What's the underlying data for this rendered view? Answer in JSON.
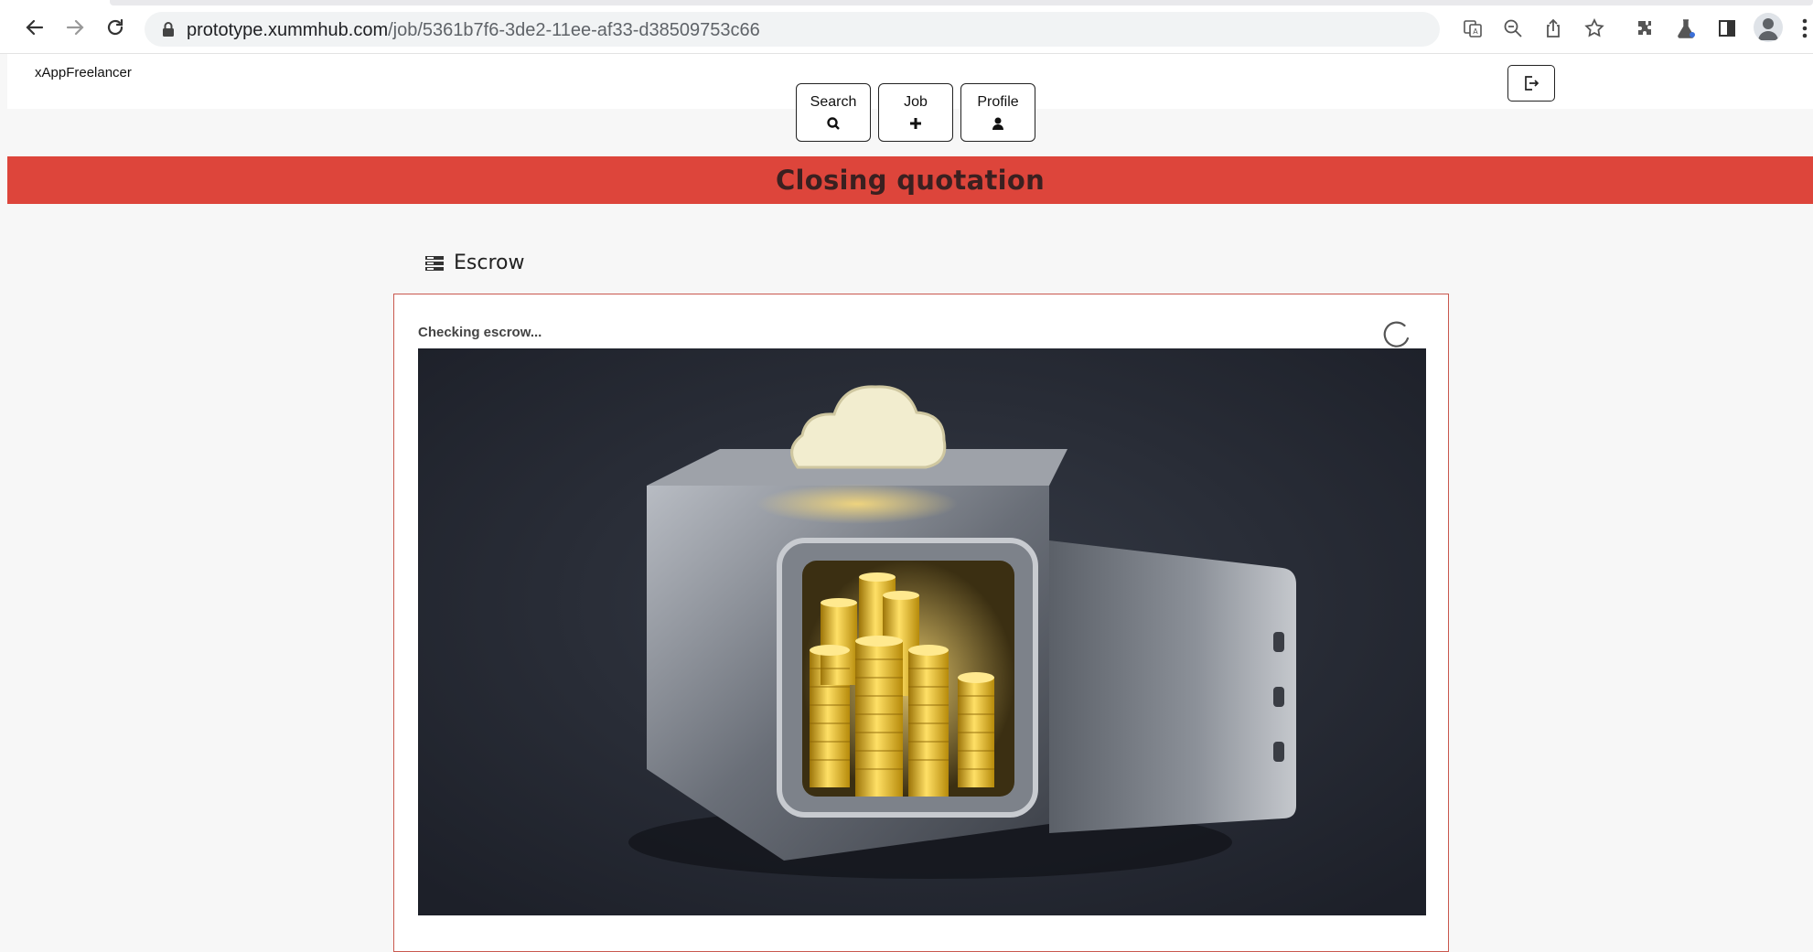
{
  "browser": {
    "url_domain": "prototype.xummhub.com",
    "url_path": "/job/5361b7f6-3de2-11ee-af33-d38509753c66",
    "nav_icons": [
      "back-icon",
      "forward-icon",
      "reload-icon"
    ],
    "toolbar_icons": [
      "translate-icon",
      "zoom-out-icon",
      "share-icon",
      "bookmark-star-icon",
      "extensions-icon",
      "labs-flask-icon",
      "side-panel-icon",
      "profile-icon",
      "menu-kebab-icon"
    ]
  },
  "app": {
    "brand": "xAppFreelancer",
    "nav": [
      {
        "label": "Search",
        "icon": "search-icon"
      },
      {
        "label": "Job",
        "icon": "plus-icon"
      },
      {
        "label": "Profile",
        "icon": "user-icon"
      }
    ],
    "logout_icon": "sign-out-icon"
  },
  "banner": {
    "title": "Closing quotation",
    "color": "#dd453b"
  },
  "escrow": {
    "section_title": "Escrow",
    "section_icon": "server-list-icon",
    "status_text": "Checking escrow...",
    "spinner_icon": "loading-spinner-icon",
    "image_subject": "safe-with-gold-coins-image",
    "border_color": "#c9584e"
  }
}
